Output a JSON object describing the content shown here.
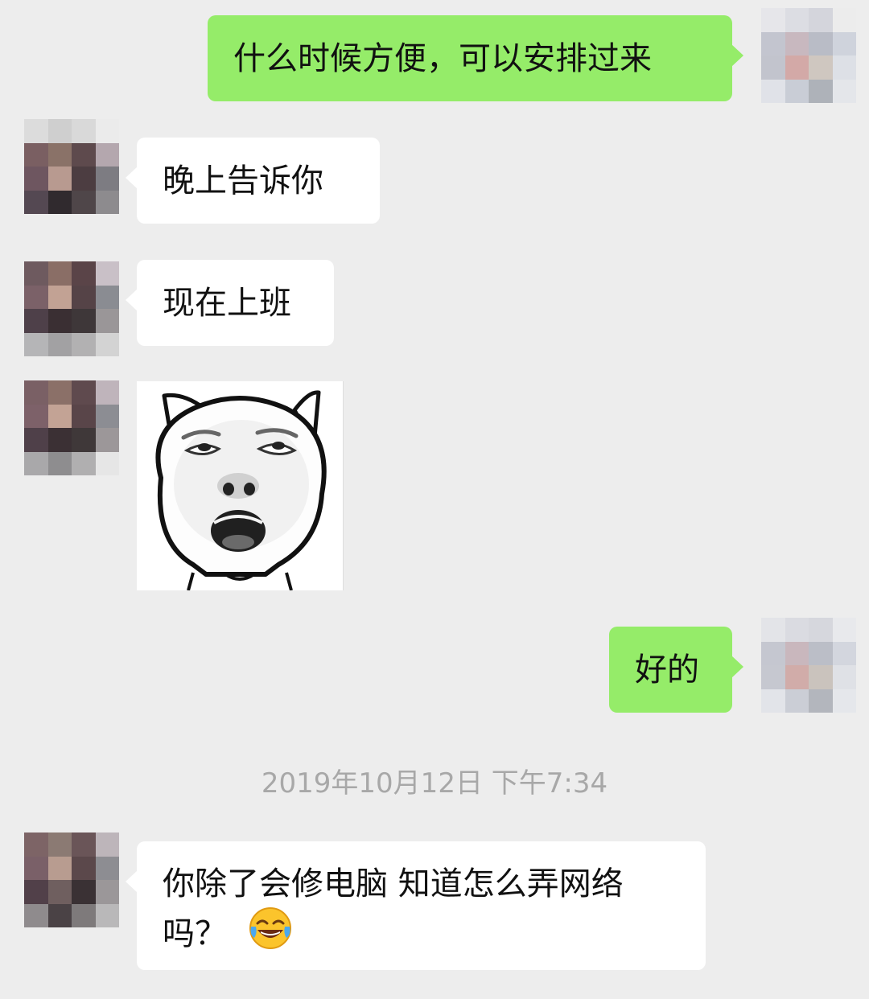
{
  "messages": [
    {
      "side": "right",
      "text": "什么时候方便，可以安排过来"
    },
    {
      "side": "left",
      "text": "晚上告诉你"
    },
    {
      "side": "left",
      "text": "现在上班"
    },
    {
      "side": "left",
      "type": "sticker",
      "sticker_icon": "laughing-pig-face-sticker"
    },
    {
      "side": "right",
      "text": "好的"
    },
    {
      "side": "left",
      "text_line1": "你除了会修电脑 知道怎么弄网络",
      "text_line2": "吗？",
      "emoji_icon": "face-with-tears-of-joy-icon"
    }
  ],
  "timestamp": "2019年10月12日 下午7:34",
  "colors": {
    "background": "#ededed",
    "sent_bubble": "#95ec69",
    "received_bubble": "#ffffff",
    "timestamp_text": "#a8a8a8"
  }
}
